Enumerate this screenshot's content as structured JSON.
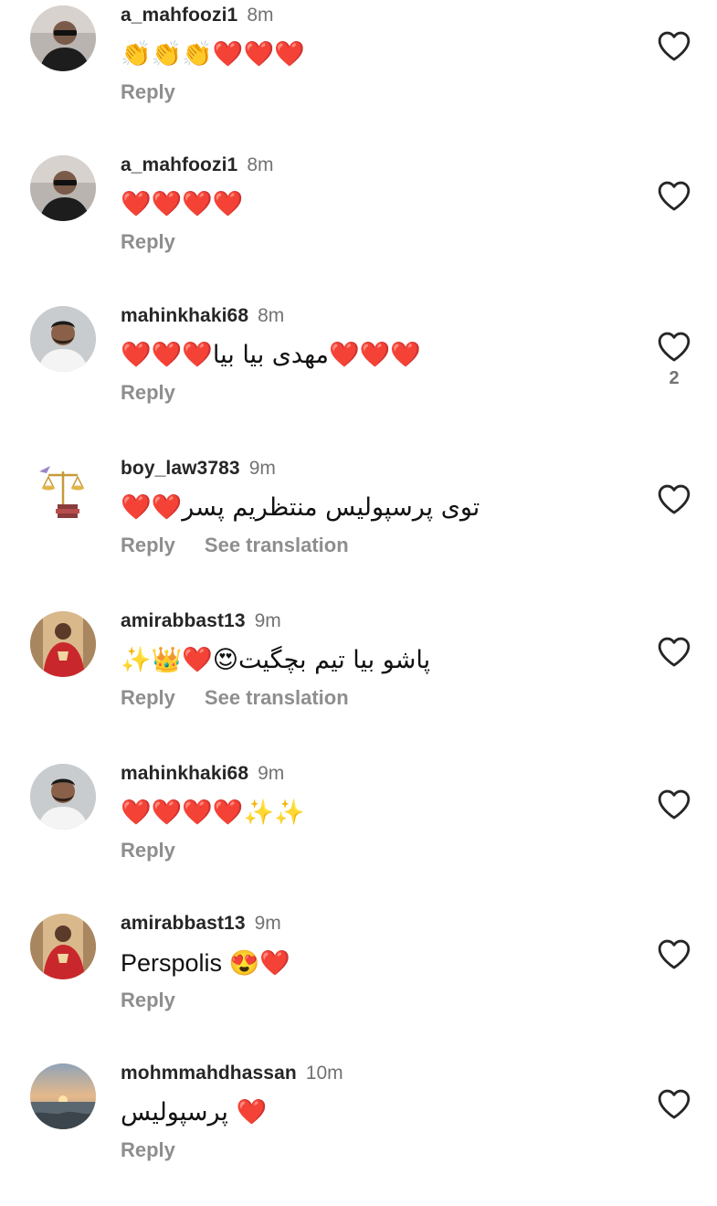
{
  "comments": [
    {
      "username": "a_mahfoozi1",
      "time": "8m",
      "text": "👏👏👏❤️❤️❤️",
      "reply_label": "Reply",
      "avatar_icon": "profile-photo-icon"
    },
    {
      "username": "a_mahfoozi1",
      "time": "8m",
      "text": "❤️❤️❤️❤️",
      "reply_label": "Reply",
      "avatar_icon": "profile-photo-icon"
    },
    {
      "username": "mahinkhaki68",
      "time": "8m",
      "text": "❤️❤️❤️مهدی بیا بیا❤️❤️❤️",
      "reply_label": "Reply",
      "like_count": "2",
      "avatar_icon": "profile-photo-icon"
    },
    {
      "username": "boy_law3783",
      "time": "9m",
      "text": "توی پرسپولیس منتظریم پسر❤️❤️",
      "reply_label": "Reply",
      "translate_label": "See translation",
      "avatar_icon": "scales-of-justice-icon"
    },
    {
      "username": "amirabbast13",
      "time": "9m",
      "text": "پاشو بیا تیم بچگیت😍❤️👑✨",
      "reply_label": "Reply",
      "translate_label": "See translation",
      "avatar_icon": "profile-photo-icon"
    },
    {
      "username": "mahinkhaki68",
      "time": "9m",
      "text": "❤️❤️❤️❤️✨✨",
      "reply_label": "Reply",
      "avatar_icon": "profile-photo-icon"
    },
    {
      "username": "amirabbast13",
      "time": "9m",
      "text": "Perspolis 😍❤️",
      "reply_label": "Reply",
      "avatar_icon": "profile-photo-icon"
    },
    {
      "username": "mohmmahdhassan",
      "time": "10m",
      "text": "❤️ پرسپولیس",
      "reply_label": "Reply",
      "avatar_icon": "sunset-photo-icon"
    }
  ],
  "colors": {
    "username": "#262626",
    "secondary_text": "#8e8e8e",
    "timestamp": "#737373",
    "like_icon_stroke": "#262626",
    "background": "#ffffff"
  },
  "icons": {
    "like": "heart-outline-icon"
  }
}
